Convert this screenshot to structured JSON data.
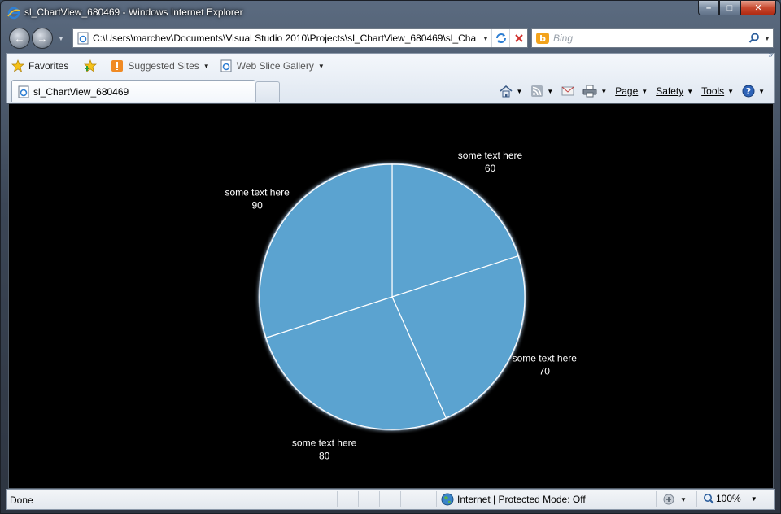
{
  "window": {
    "title": "sl_ChartView_680469 - Windows Internet Explorer",
    "minimize": "–",
    "maximize": "□",
    "close": "✕"
  },
  "nav": {
    "back": "←",
    "forward": "→",
    "address": "C:\\Users\\marchev\\Documents\\Visual Studio 2010\\Projects\\sl_ChartView_680469\\sl_Cha",
    "search_placeholder": "Bing"
  },
  "favorites_bar": {
    "favorites": "Favorites",
    "suggested_sites": "Suggested Sites",
    "web_slice_gallery": "Web Slice Gallery"
  },
  "tab": {
    "label": "sl_ChartView_680469"
  },
  "command_bar": {
    "page": "Page",
    "safety": "Safety",
    "tools": "Tools",
    "more": "»"
  },
  "chart_data": {
    "type": "pie",
    "slices": [
      {
        "label": "some text here",
        "value": 60
      },
      {
        "label": "some text here",
        "value": 70
      },
      {
        "label": "some text here",
        "value": 80
      },
      {
        "label": "some text here",
        "value": 90
      }
    ],
    "colors": {
      "slice": "#5ba3d0",
      "stroke": "#ffffff",
      "background": "#000000",
      "label": "#ffffff"
    }
  },
  "status_bar": {
    "left": "Done",
    "zone": "Internet | Protected Mode: Off",
    "zoom": "100%"
  },
  "icons": {
    "ie": "ie-icon",
    "star": "star-icon",
    "home": "home-icon",
    "feeds": "feeds-icon",
    "mail": "mail-icon",
    "print": "print-icon",
    "help": "help-icon",
    "globe": "globe-icon",
    "refresh": "refresh-icon",
    "stop": "stop-icon",
    "search": "search-icon"
  }
}
